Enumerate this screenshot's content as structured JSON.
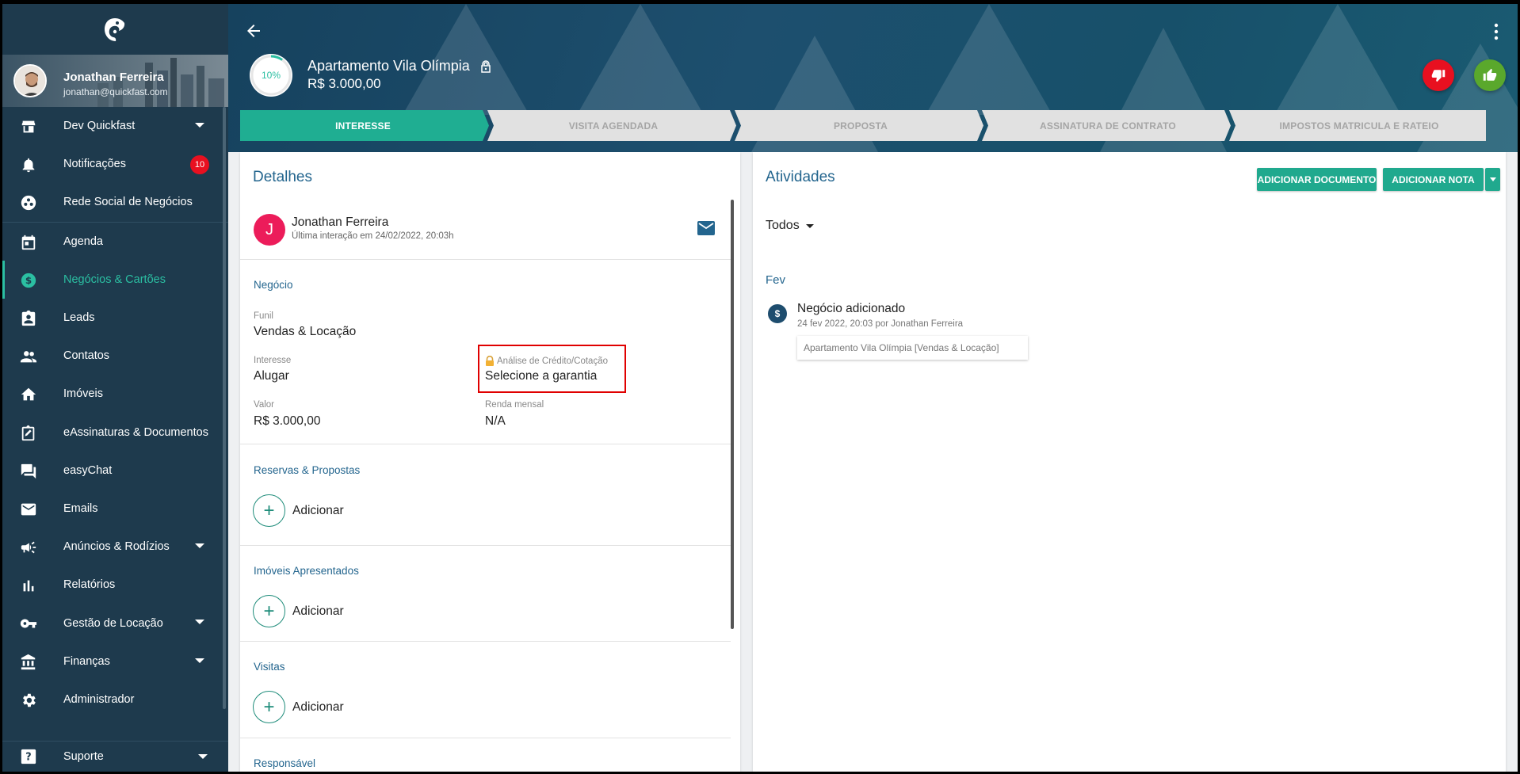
{
  "sidebar": {
    "profile": {
      "name": "Jonathan Ferreira",
      "email": "jonathan@quickfast.com"
    },
    "items": [
      {
        "label": "Dev Quickfast",
        "icon": "store-icon",
        "dropdown": true
      },
      {
        "label": "Notificações",
        "icon": "bell-icon",
        "badge": "10"
      },
      {
        "label": "Rede Social de Negócios",
        "icon": "network-icon"
      },
      {
        "label": "Agenda",
        "icon": "calendar-icon"
      },
      {
        "label": "Negócios & Cartões",
        "icon": "dollar-icon",
        "active": true
      },
      {
        "label": "Leads",
        "icon": "contact-badge-icon"
      },
      {
        "label": "Contatos",
        "icon": "people-icon"
      },
      {
        "label": "Imóveis",
        "icon": "home-icon"
      },
      {
        "label": "eAssinaturas & Documentos",
        "icon": "sign-document-icon"
      },
      {
        "label": "easyChat",
        "icon": "chat-icon"
      },
      {
        "label": "Emails",
        "icon": "mail-icon"
      },
      {
        "label": "Anúncios & Rodízios",
        "icon": "megaphone-icon",
        "dropdown": true
      },
      {
        "label": "Relatórios",
        "icon": "bar-chart-icon"
      },
      {
        "label": "Gestão de Locação",
        "icon": "key-icon",
        "dropdown": true
      },
      {
        "label": "Finanças",
        "icon": "bank-icon",
        "dropdown": true
      },
      {
        "label": "Administrador",
        "icon": "gear-icon"
      }
    ],
    "support": {
      "label": "Suporte",
      "icon": "help-icon"
    }
  },
  "header": {
    "title": "Apartamento Vila Olímpia",
    "value": "R$ 3.000,00",
    "progress_label": "10%",
    "progress": 0.1,
    "colors": {
      "lose": "#e81020",
      "win": "#5aa82c",
      "accent": "#2bbfa2"
    }
  },
  "stages": [
    {
      "label": "INTERESSE",
      "active": true
    },
    {
      "label": "VISITA AGENDADA",
      "active": false
    },
    {
      "label": "PROPOSTA",
      "active": false
    },
    {
      "label": "ASSINATURA DE CONTRATO",
      "active": false
    },
    {
      "label": "IMPOSTOS MATRICULA E RATEIO",
      "active": false
    }
  ],
  "details": {
    "title": "Detalhes",
    "contact": {
      "initial": "J",
      "name": "Jonathan Ferreira",
      "last_interaction": "Última interação em 24/02/2022, 20:03h"
    },
    "negocio": {
      "section_title": "Negócio",
      "funil_label": "Funil",
      "funil_value": "Vendas & Locação",
      "interesse_label": "Interesse",
      "interesse_value": "Alugar",
      "analise_label": "Análise de Crédito/Cotação",
      "analise_value": "Selecione a garantia",
      "valor_label": "Valor",
      "valor_value": "R$ 3.000,00",
      "renda_label": "Renda mensal",
      "renda_value": "N/A"
    },
    "reservas": {
      "title": "Reservas & Propostas",
      "add": "Adicionar"
    },
    "imoveis": {
      "title": "Imóveis Apresentados",
      "add": "Adicionar"
    },
    "visitas": {
      "title": "Visitas",
      "add": "Adicionar"
    },
    "responsavel": {
      "title": "Responsável"
    }
  },
  "activities": {
    "title": "Atividades",
    "btn_doc": "ADICIONAR DOCUMENTO",
    "btn_note": "ADICIONAR NOTA",
    "filter": "Todos",
    "month": "Fev",
    "item": {
      "title": "Negócio adicionado",
      "sub": "24 fev 2022, 20:03 por Jonathan Ferreira",
      "card": "Apartamento Vila Olímpia [Vendas & Locação]"
    }
  }
}
